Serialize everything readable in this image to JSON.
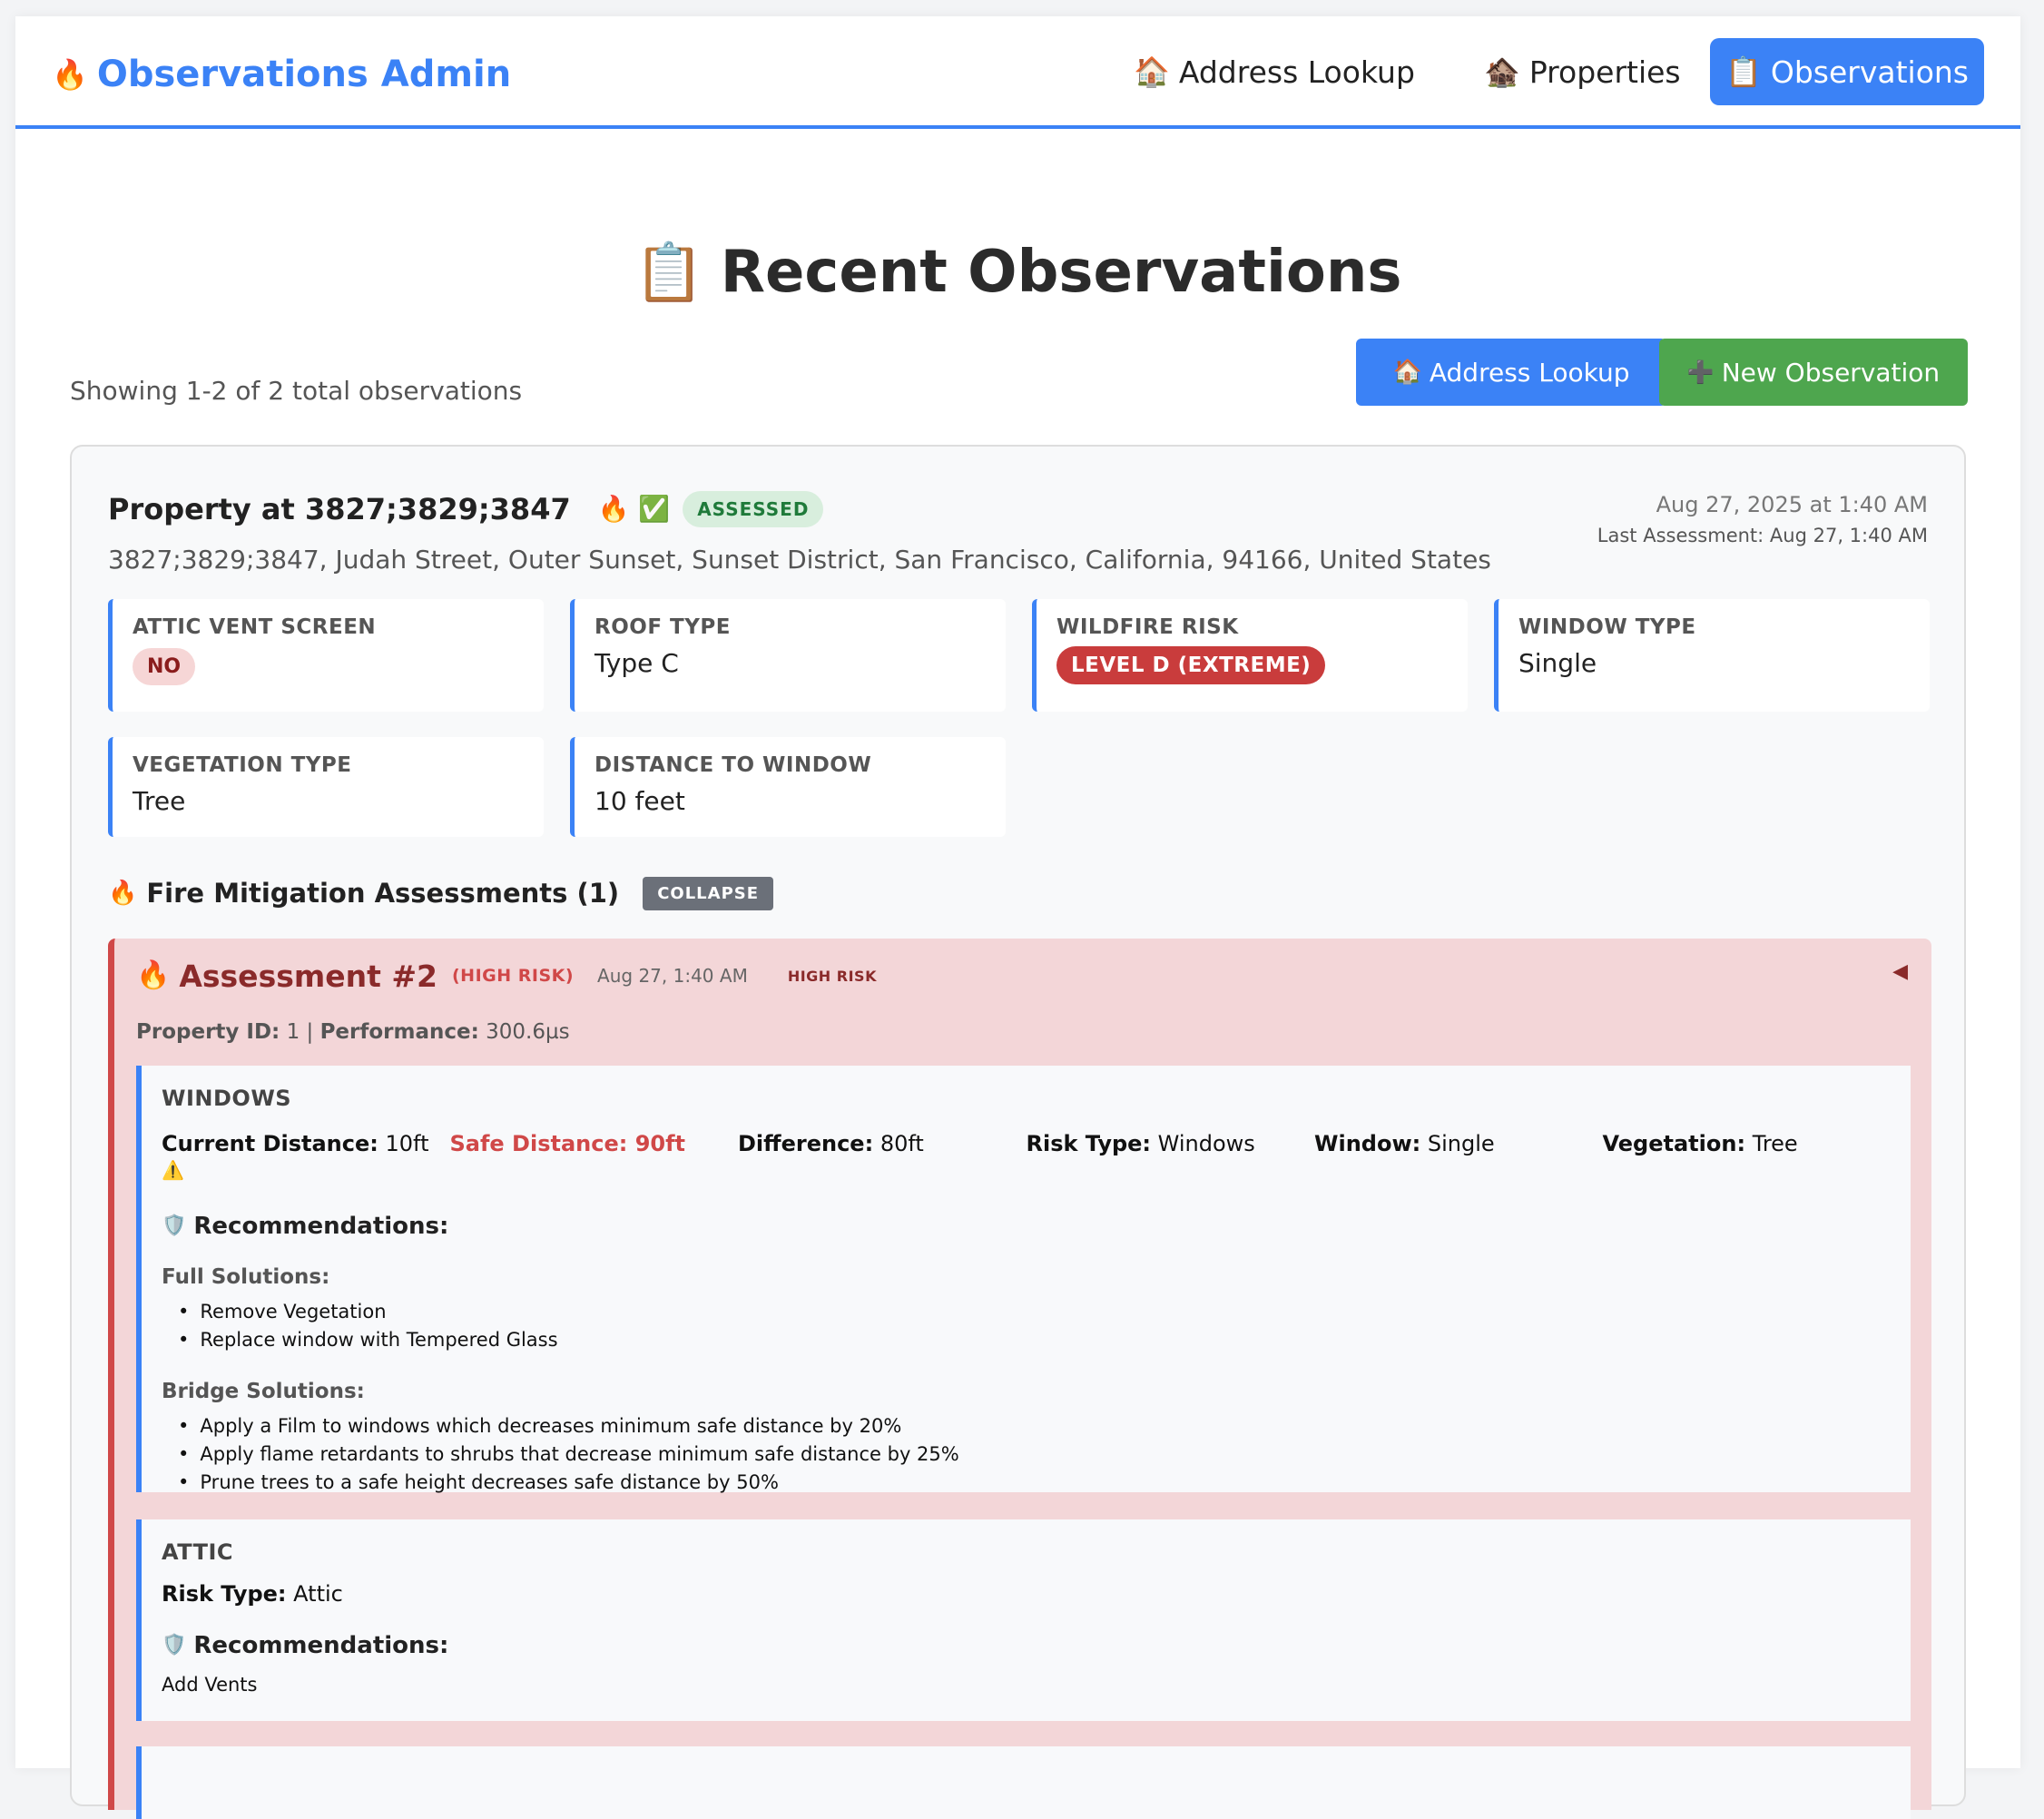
{
  "nav": {
    "brand": "Observations Admin",
    "brand_icon": "🔥",
    "links": [
      {
        "icon": "🏠",
        "label": "Address Lookup"
      },
      {
        "icon": "🏚️",
        "label": "Properties"
      },
      {
        "icon": "📋",
        "label": "Observations",
        "active": true
      }
    ]
  },
  "header": {
    "title_icon": "📋",
    "title": "Recent Observations",
    "count_text": "Showing 1-2 of 2 total observations",
    "address_lookup_icon": "🏠",
    "address_lookup_label": "Address Lookup",
    "new_observation_icon": "➕",
    "new_observation_label": "New Observation"
  },
  "colors": {
    "primary": "#3b82f6",
    "success": "#4ea64e",
    "danger": "#d04848",
    "assessment_bg": "#f3d6d8"
  },
  "observation": {
    "title": "Property at 3827;3829;3847",
    "status_icons": "🔥 ✅",
    "status_badge": "ASSESSED",
    "address": "3827;3829;3847, Judah Street, Outer Sunset, Sunset District, San Francisco, California, 94166, United States",
    "date": "Aug 27, 2025 at 1:40 AM",
    "last_assessment": "Last Assessment: Aug 27, 1:40 AM",
    "fields": {
      "attic_vent_label": "ATTIC VENT SCREEN",
      "attic_vent_value": "NO",
      "roof_type_label": "ROOF TYPE",
      "roof_type_value": "Type C",
      "wildfire_risk_label": "WILDFIRE RISK",
      "wildfire_risk_value": "LEVEL D (EXTREME)",
      "window_type_label": "WINDOW TYPE",
      "window_type_value": "Single",
      "vegetation_type_label": "VEGETATION TYPE",
      "vegetation_type_value": "Tree",
      "distance_label": "DISTANCE TO WINDOW",
      "distance_value": "10 feet"
    },
    "mitigation": {
      "icon": "🔥",
      "heading": "Fire Mitigation Assessments (1)",
      "collapse_label": "COLLAPSE"
    },
    "assessment": {
      "icon": "🔥",
      "title": "Assessment #2",
      "risk_small": "(HIGH RISK)",
      "date": "Aug 27, 1:40 AM",
      "risk_tag": "HIGH RISK",
      "toggle": "◀",
      "property_id_label": "Property ID:",
      "property_id_value": "1",
      "performance_label": "Performance:",
      "performance_value": "300.6µs",
      "windows": {
        "title": "WINDOWS",
        "current_distance_label": "Current Distance:",
        "current_distance_value": "10ft",
        "warning_icon": "⚠️",
        "safe_distance": "Safe Distance: 90ft",
        "difference_label": "Difference:",
        "difference_value": "80ft",
        "risk_type_label": "Risk Type:",
        "risk_type_value": "Windows",
        "window_label": "Window:",
        "window_value": "Single",
        "vegetation_label": "Vegetation:",
        "vegetation_value": "Tree",
        "recommendations_icon": "🛡️",
        "recommendations_label": "Recommendations:",
        "full_solutions_label": "Full Solutions:",
        "full_solutions": [
          "Remove Vegetation",
          "Replace window with Tempered Glass"
        ],
        "bridge_solutions_label": "Bridge Solutions:",
        "bridge_solutions": [
          "Apply a Film to windows which decreases minimum safe distance by 20%",
          "Apply flame retardants to shrubs that decrease minimum safe distance by 25%",
          "Prune trees to a safe height decreases safe distance by 50%"
        ]
      },
      "attic": {
        "title": "ATTIC",
        "risk_type_label": "Risk Type:",
        "risk_type_value": "Attic",
        "recommendations_icon": "🛡️",
        "recommendations_label": "Recommendations:",
        "recommendation": "Add Vents"
      }
    }
  }
}
